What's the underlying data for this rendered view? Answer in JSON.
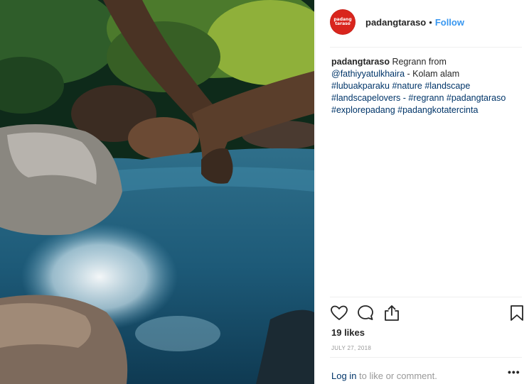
{
  "post": {
    "username": "padangtaraso",
    "avatar_text": "padang taraso",
    "separator": "•",
    "follow_label": "Follow",
    "caption": {
      "user": "padangtaraso",
      "line1_text": " Regrann from",
      "mention": "@fathiyyatulkhaira",
      "line2_text": " - Kolam alam",
      "line3": "#lubuakparaku #nature #landscape",
      "line4": "#landscapelovers - #regrann #padangtaraso",
      "line5": "#explorepadang #padangkotatercinta"
    },
    "likes": "19 likes",
    "date": "JULY 27, 2018",
    "login_link": "Log in",
    "login_rest": " to like or comment.",
    "more_label": "•••"
  },
  "icons": {
    "like": "heart-icon",
    "comment": "comment-bubble-icon",
    "share": "share-icon",
    "save": "bookmark-icon",
    "more": "more-options-icon"
  },
  "colors": {
    "accent": "#3897f0",
    "link": "#003569",
    "avatar_bg": "#d9251d",
    "muted": "#999999"
  }
}
